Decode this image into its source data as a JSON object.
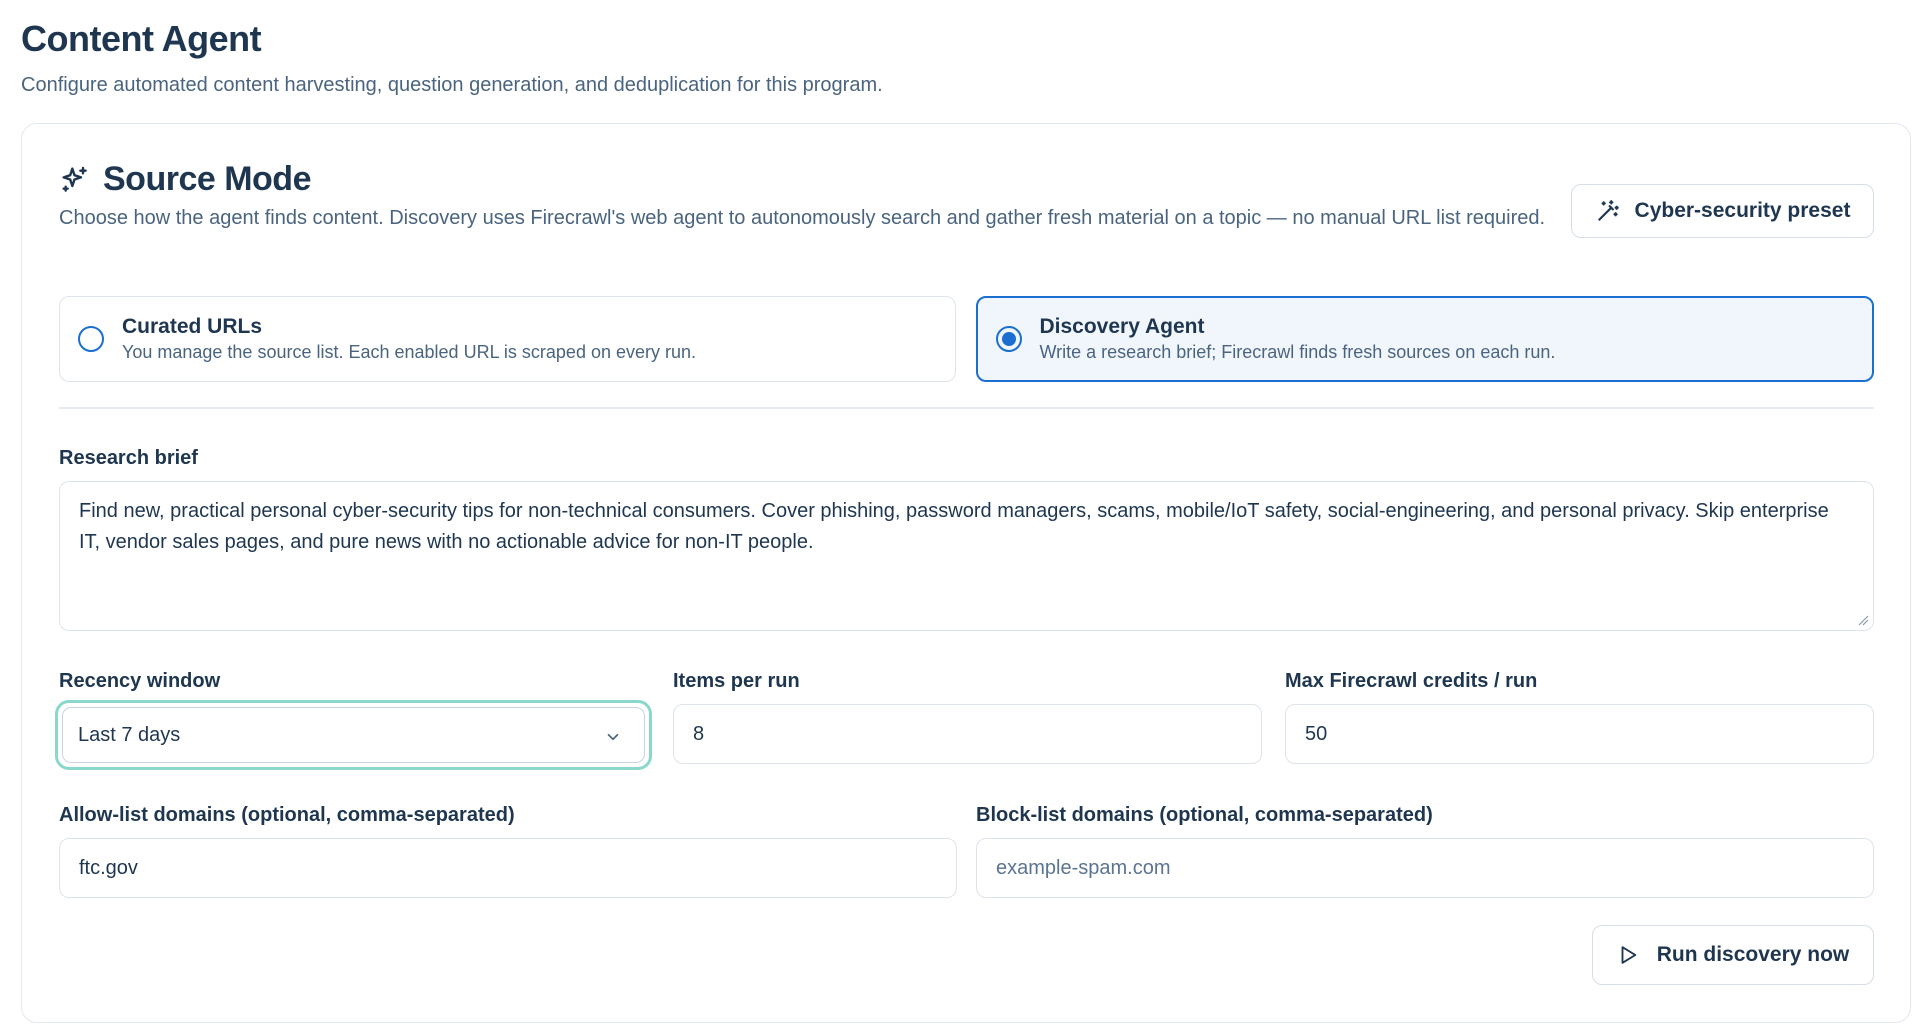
{
  "header": {
    "title": "Content Agent",
    "subtitle": "Configure automated content harvesting, question generation, and deduplication for this program."
  },
  "source_mode": {
    "title": "Source Mode",
    "description": "Choose how the agent finds content. Discovery uses Firecrawl's web agent to autonomously search and gather fresh material on a topic — no manual URL list required.",
    "preset_label": "Cyber-security preset",
    "options": [
      {
        "label": "Curated URLs",
        "description": "You manage the source list. Each enabled URL is scraped on every run.",
        "selected": false
      },
      {
        "label": "Discovery Agent",
        "description": "Write a research brief; Firecrawl finds fresh sources on each run.",
        "selected": true
      }
    ]
  },
  "form": {
    "brief_label": "Research brief",
    "brief_value": "Find new, practical personal cyber-security tips for non-technical consumers. Cover phishing, password managers, scams, mobile/IoT safety, social-engineering, and personal privacy. Skip enterprise IT, vendor sales pages, and pure news with no actionable advice for non-IT people.",
    "recency_label": "Recency window",
    "recency_value": "Last 7 days",
    "items_label": "Items per run",
    "items_value": "8",
    "credits_label": "Max Firecrawl credits / run",
    "credits_value": "50",
    "allow_label": "Allow-list domains (optional, comma-separated)",
    "allow_value": "ftc.gov",
    "block_label": "Block-list domains (optional, comma-separated)",
    "block_placeholder": "example-spam.com",
    "run_label": "Run discovery now"
  },
  "colors": {
    "accent": "#1a6fd1",
    "focus_ring": "#8ad8cb",
    "text": "#1e3650",
    "muted": "#4a6480"
  }
}
